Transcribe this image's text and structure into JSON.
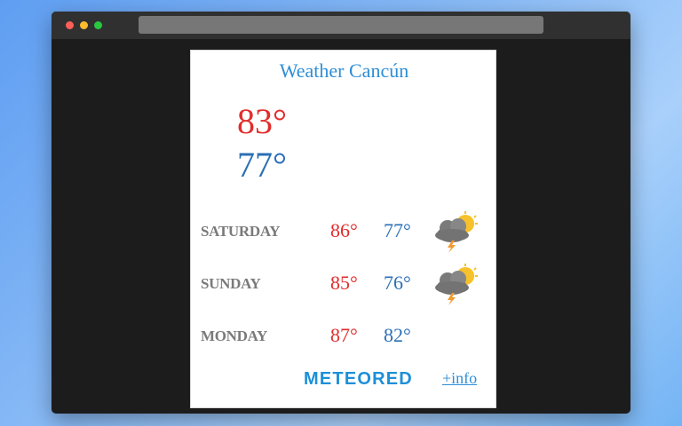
{
  "widget": {
    "title": "Weather Cancún",
    "current": {
      "high": "83°",
      "low": "77°"
    },
    "forecast": [
      {
        "day": "SATURDAY",
        "high": "86°",
        "low": "77°",
        "icon": "storm-cloud-sun-icon"
      },
      {
        "day": "SUNDAY",
        "high": "85°",
        "low": "76°",
        "icon": "storm-cloud-sun-icon"
      },
      {
        "day": "MONDAY",
        "high": "87°",
        "low": "82°",
        "icon": ""
      }
    ],
    "brand": "METEORED",
    "info_link": "+info"
  },
  "colors": {
    "high": "#e12d2d",
    "low": "#2b6fb6",
    "brand": "#1d8fd8",
    "title": "#2e8ed6",
    "day": "#7a7a7a"
  }
}
